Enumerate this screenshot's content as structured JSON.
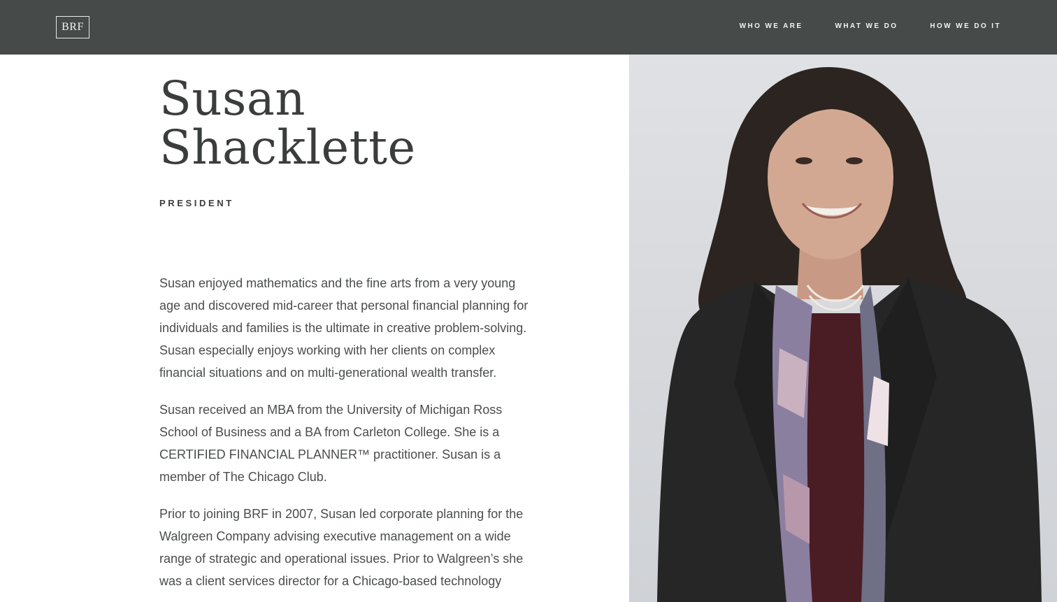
{
  "header": {
    "logo_text": "BRF",
    "nav": [
      {
        "label": "WHO WE ARE"
      },
      {
        "label": "WHAT WE DO"
      },
      {
        "label": "HOW WE DO IT"
      }
    ]
  },
  "profile": {
    "first_name": "Susan",
    "last_name": "Shacklette",
    "title": "PRESIDENT",
    "bio": [
      "Susan enjoyed mathematics and the fine arts from a very young age and discovered mid-career that personal financial planning for individuals and families is the ultimate in creative problem-solving. Susan especially enjoys working with her clients on complex financial situations and on multi-generational wealth transfer.",
      "Susan received an MBA from the University of Michigan Ross School of Business and a BA from Carleton College. She is a CERTIFIED FINANCIAL PLANNER™ practitioner. Susan is a member of The Chicago Club.",
      "Prior to joining BRF in 2007, Susan led corporate planning for the Walgreen Company advising executive management on a wide range of strategic and operational issues. Prior to Walgreen’s she was a client services director for a Chicago-based technology"
    ]
  },
  "colors": {
    "header_bg": "#464a49",
    "heading_text": "#3b3d3d",
    "body_text": "#4b4d4d",
    "photo_bg": "#d9dbdf"
  },
  "icons": {
    "portrait": "portrait-photo"
  }
}
